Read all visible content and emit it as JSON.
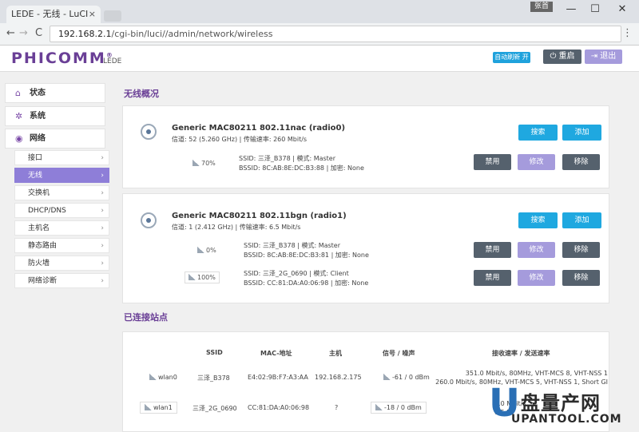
{
  "browser": {
    "tab_title": "LEDE - 无线 - LuCI",
    "tab_close": "×",
    "user_badge": "张首",
    "url_host": "192.168.2.1",
    "url_path": "/cgi-bin/luci//admin/network/wireless",
    "back": "←",
    "forward": "→",
    "reload": "C",
    "menu": "⋮",
    "minimize": "—",
    "maximize": "☐",
    "close": "✕"
  },
  "header": {
    "logo": "PHICOMM",
    "logo_mark": "®",
    "logo_sub": "LEDE",
    "auto_refresh": "自动刷新 开",
    "reboot": "重启",
    "logout": "退出"
  },
  "sidebar": {
    "main": [
      {
        "icon": "⌂",
        "label": "状态"
      },
      {
        "icon": "✲",
        "label": "系统"
      },
      {
        "icon": "◉",
        "label": "网络"
      }
    ],
    "sub": [
      {
        "label": "接口"
      },
      {
        "label": "无线",
        "active": true
      },
      {
        "label": "交换机"
      },
      {
        "label": "DHCP/DNS"
      },
      {
        "label": "主机名"
      },
      {
        "label": "静态路由"
      },
      {
        "label": "防火墙"
      },
      {
        "label": "网络诊断"
      }
    ],
    "arrow": "›"
  },
  "overview": {
    "title": "无线概况",
    "radio0": {
      "name": "Generic MAC80211 802.11nac (radio0)",
      "detail": "信道: 52 (5.260 GHz) | 传输速率: 260 Mbit/s",
      "scan": "搜索",
      "add": "添加",
      "nets": [
        {
          "signal": "70%",
          "ssid_line": "SSID: 三泽_B378 | 模式: Master",
          "bssid_line": "BSSID: 8C:AB:8E:DC:B3:88 | 加密: None"
        }
      ]
    },
    "radio1": {
      "name": "Generic MAC80211 802.11bgn (radio1)",
      "detail": "信道: 1 (2.412 GHz) | 传输速率: 6.5 Mbit/s",
      "scan": "搜索",
      "add": "添加",
      "nets": [
        {
          "signal": "0%",
          "ssid_line": "SSID: 三泽_B378 | 模式: Master",
          "bssid_line": "BSSID: 8C:AB:8E:DC:B3:81 | 加密: None"
        },
        {
          "signal": "100%",
          "ssid_line": "SSID: 三泽_2G_0690 | 模式: Client",
          "bssid_line": "BSSID: CC:81:DA:A0:06:98 | 加密: None"
        }
      ]
    },
    "disable": "禁用",
    "edit": "修改",
    "remove": "移除"
  },
  "stations": {
    "title": "已连接站点",
    "headers": [
      "SSID",
      "MAC-地址",
      "主机",
      "信号 / 噪声",
      "接收速率 / 发送速率"
    ],
    "rows": [
      {
        "iface": "wlan0",
        "ssid": "三泽_B378",
        "mac": "E4:02:9B:F7:A3:AA",
        "host": "192.168.2.175",
        "signal": "-61 / 0 dBm",
        "rx": "351.0 Mbit/s, 80MHz, VHT-MCS 8, VHT-NSS 1",
        "tx": "260.0 Mbit/s, 80MHz, VHT-MCS 5, VHT-NSS 1, Short GI"
      },
      {
        "iface": "wlan1",
        "ssid": "三泽_2G_0690",
        "mac": "CC:81:DA:A0:06:98",
        "host": "?",
        "signal": "-18 / 0 dBm",
        "rx": "0.0 Mbit/s",
        "tx": "6.5 M"
      }
    ]
  },
  "watermark": {
    "u": "U",
    "cn": "盘量产网",
    "url": "UPANTOOL.COM"
  }
}
